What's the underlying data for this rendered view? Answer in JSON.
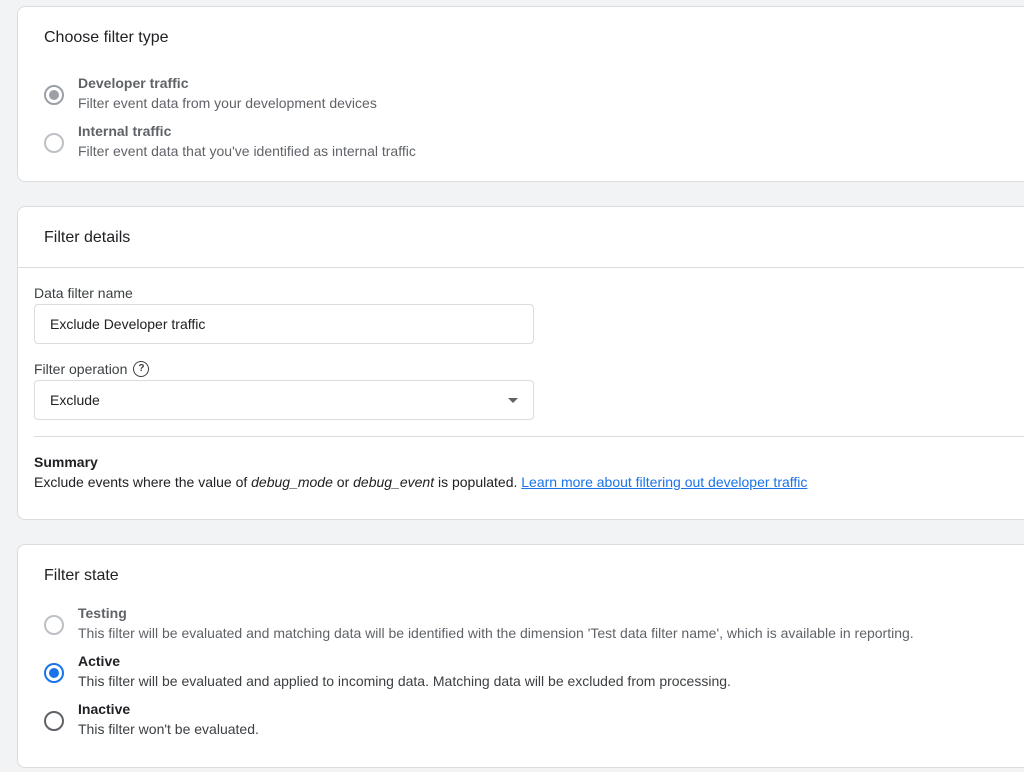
{
  "filter_type": {
    "title": "Choose filter type",
    "options": [
      {
        "label": "Developer traffic",
        "description": "Filter event data from your development devices",
        "selected": true,
        "disabled": true
      },
      {
        "label": "Internal traffic",
        "description": "Filter event data that you've identified as internal traffic",
        "selected": false,
        "disabled": true
      }
    ]
  },
  "filter_details": {
    "title": "Filter details",
    "name_label": "Data filter name",
    "name_value": "Exclude Developer traffic",
    "operation_label": "Filter operation",
    "help_icon": "?",
    "operation_value": "Exclude",
    "summary_title": "Summary",
    "summary_prefix": "Exclude events where the value of ",
    "summary_param1": "debug_mode",
    "summary_or": " or ",
    "summary_param2": "debug_event",
    "summary_suffix": " is populated. ",
    "summary_link": "Learn more about filtering out developer traffic"
  },
  "filter_state": {
    "title": "Filter state",
    "options": [
      {
        "label": "Testing",
        "description": "This filter will be evaluated and matching data will be identified with the dimension 'Test data filter name', which is available in reporting.",
        "selected": false,
        "disabled": true
      },
      {
        "label": "Active",
        "description": "This filter will be evaluated and applied to incoming data. Matching data will be excluded from processing.",
        "selected": true,
        "disabled": false
      },
      {
        "label": "Inactive",
        "description": "This filter won't be evaluated.",
        "selected": false,
        "disabled": false
      }
    ]
  },
  "colors": {
    "accent": "#1a73e8",
    "background": "#f1f3f4",
    "border": "#dadce0"
  }
}
